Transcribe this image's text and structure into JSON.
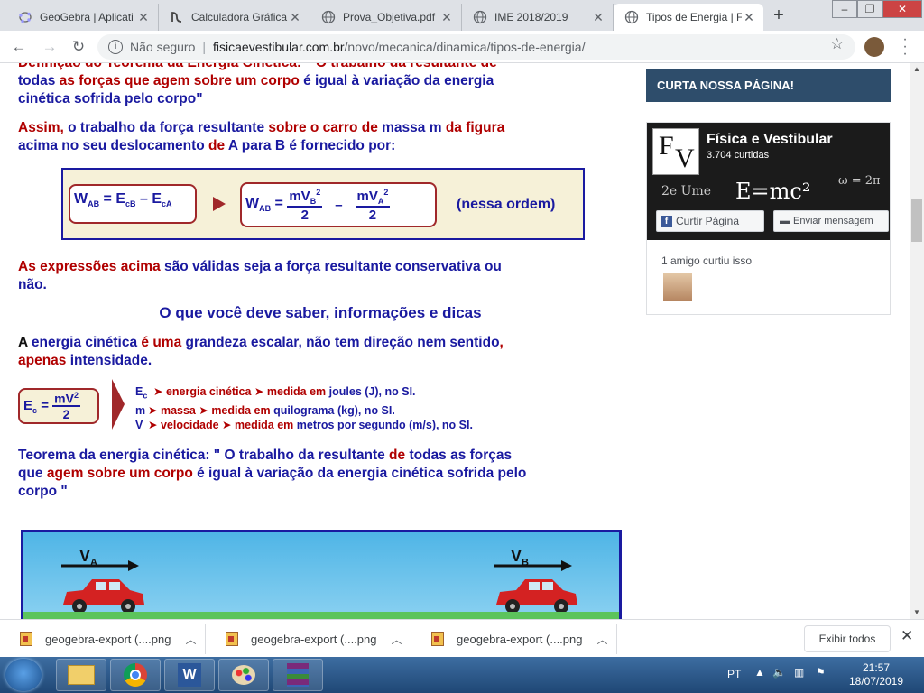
{
  "tabs": [
    {
      "title": "GeoGebra | Aplicati",
      "icon": "geogebra-icon"
    },
    {
      "title": "Calculadora Gráfica",
      "icon": "desmos-icon"
    },
    {
      "title": "Prova_Objetiva.pdf",
      "icon": "globe-icon"
    },
    {
      "title": "IME 2018/2019",
      "icon": "globe-icon"
    },
    {
      "title": "Tipos de Energia | F",
      "icon": "globe-icon",
      "active": true
    }
  ],
  "new_tab_label": "+",
  "toolbar": {
    "not_secure": "Não seguro",
    "separator": "|",
    "domain": "fisicaevestibular.com.br",
    "path": "/novo/mecanica/dinamica/tipos-de-energia/"
  },
  "article": {
    "para_top_a": "Definição do Teorema da Energia Cinética: \" O trabalho da resultante de",
    "para_top_b1": "todas ",
    "para_top_b2": "as forças que agem sobre um corpo",
    "para_top_b3": " é igual à variação da energia",
    "para_top_c": "cinética sofrida pelo corpo\"",
    "assim_1": "Assim,",
    "assim_2": " o trabalho da força resultante ",
    "assim_3": "sobre o carro de",
    "assim_4": " massa m ",
    "assim_5": "da figura",
    "assim_6": "acima no seu deslocamento ",
    "assim_7": "de",
    "assim_8": " A para B ",
    "assim_9": "é fornecido por:",
    "eq_w": "W",
    "eq_ab": "AB",
    "eq_eq": " = E",
    "eq_cb": "cB",
    "eq_minus": " – E",
    "eq_ca": "cA",
    "eq2_num1": "mV",
    "eq2_sub_b": "B",
    "eq2_sq": "2",
    "eq2_den": "2",
    "eq2_num2": "mV",
    "eq2_sub_a": "A",
    "eq2_minus": "–",
    "eq_order": "(nessa ordem)",
    "expr_1": "As expressões acima",
    "expr_2": " são válidas seja a força resultante conservativa ou",
    "expr_3": "não.",
    "heading": "O que você deve saber, informações e dicas",
    "ec_1": "A",
    "ec_2": " energia cinética ",
    "ec_3": "é uma",
    "ec_4": " grandeza escalar",
    "ec_5": ", não tem direção nem sentido",
    "ec_6": ",",
    "ec_7": "apenas",
    "ec_8": " intensidade.",
    "ec_formula_lhs": "E",
    "ec_formula_sub": "c",
    "ec_formula_num": "mV",
    "ec_formula_sq": "2",
    "ec_formula_den": "2",
    "legend": [
      {
        "sym": "E",
        "sub": "c",
        "name": "energia cinética",
        "unit1": "medida em",
        "unit2": "joules (J), no SI."
      },
      {
        "sym": "m",
        "sub": "",
        "name": "massa",
        "unit1": "medida em",
        "unit2": "quilograma (kg), no SI."
      },
      {
        "sym": "V",
        "sub": "",
        "name": "velocidade",
        "unit1": "medida em",
        "unit2": "metros por segundo (m/s), no SI."
      }
    ],
    "teorema_1": "Teorema da energia cinética: \" O trabalho da resultante ",
    "teorema_2": "de",
    "teorema_3": " todas as forças",
    "teorema_4": "que ",
    "teorema_5": "agem sobre um corpo",
    "teorema_6": " é igual à variação da energia cinética sofrida pelo",
    "teorema_7": "corpo \"",
    "car_label_a": "V",
    "car_label_a_sub": "A",
    "car_label_b": "V",
    "car_label_b_sub": "B"
  },
  "sidebar": {
    "header": "CURTA NOSSA PÁGINA!",
    "page_name": "Física e Vestibular",
    "likes": "3.704 curtidas",
    "like_button": "Curtir Página",
    "message_button": "Enviar mensagem",
    "friend_likes": "1 amigo curtiu isso",
    "logo_f": "F",
    "logo_v": "V",
    "cover_formula": "E=mc²",
    "cover_scribble_1": "2e Ume",
    "cover_scribble_2": "ω = 2π"
  },
  "downloads": [
    {
      "name": "geogebra-export (....png"
    },
    {
      "name": "geogebra-export (....png"
    },
    {
      "name": "geogebra-export (....png"
    }
  ],
  "show_all": "Exibir todos",
  "taskbar": {
    "lang": "PT",
    "time": "21:57",
    "date": "18/07/2019"
  }
}
